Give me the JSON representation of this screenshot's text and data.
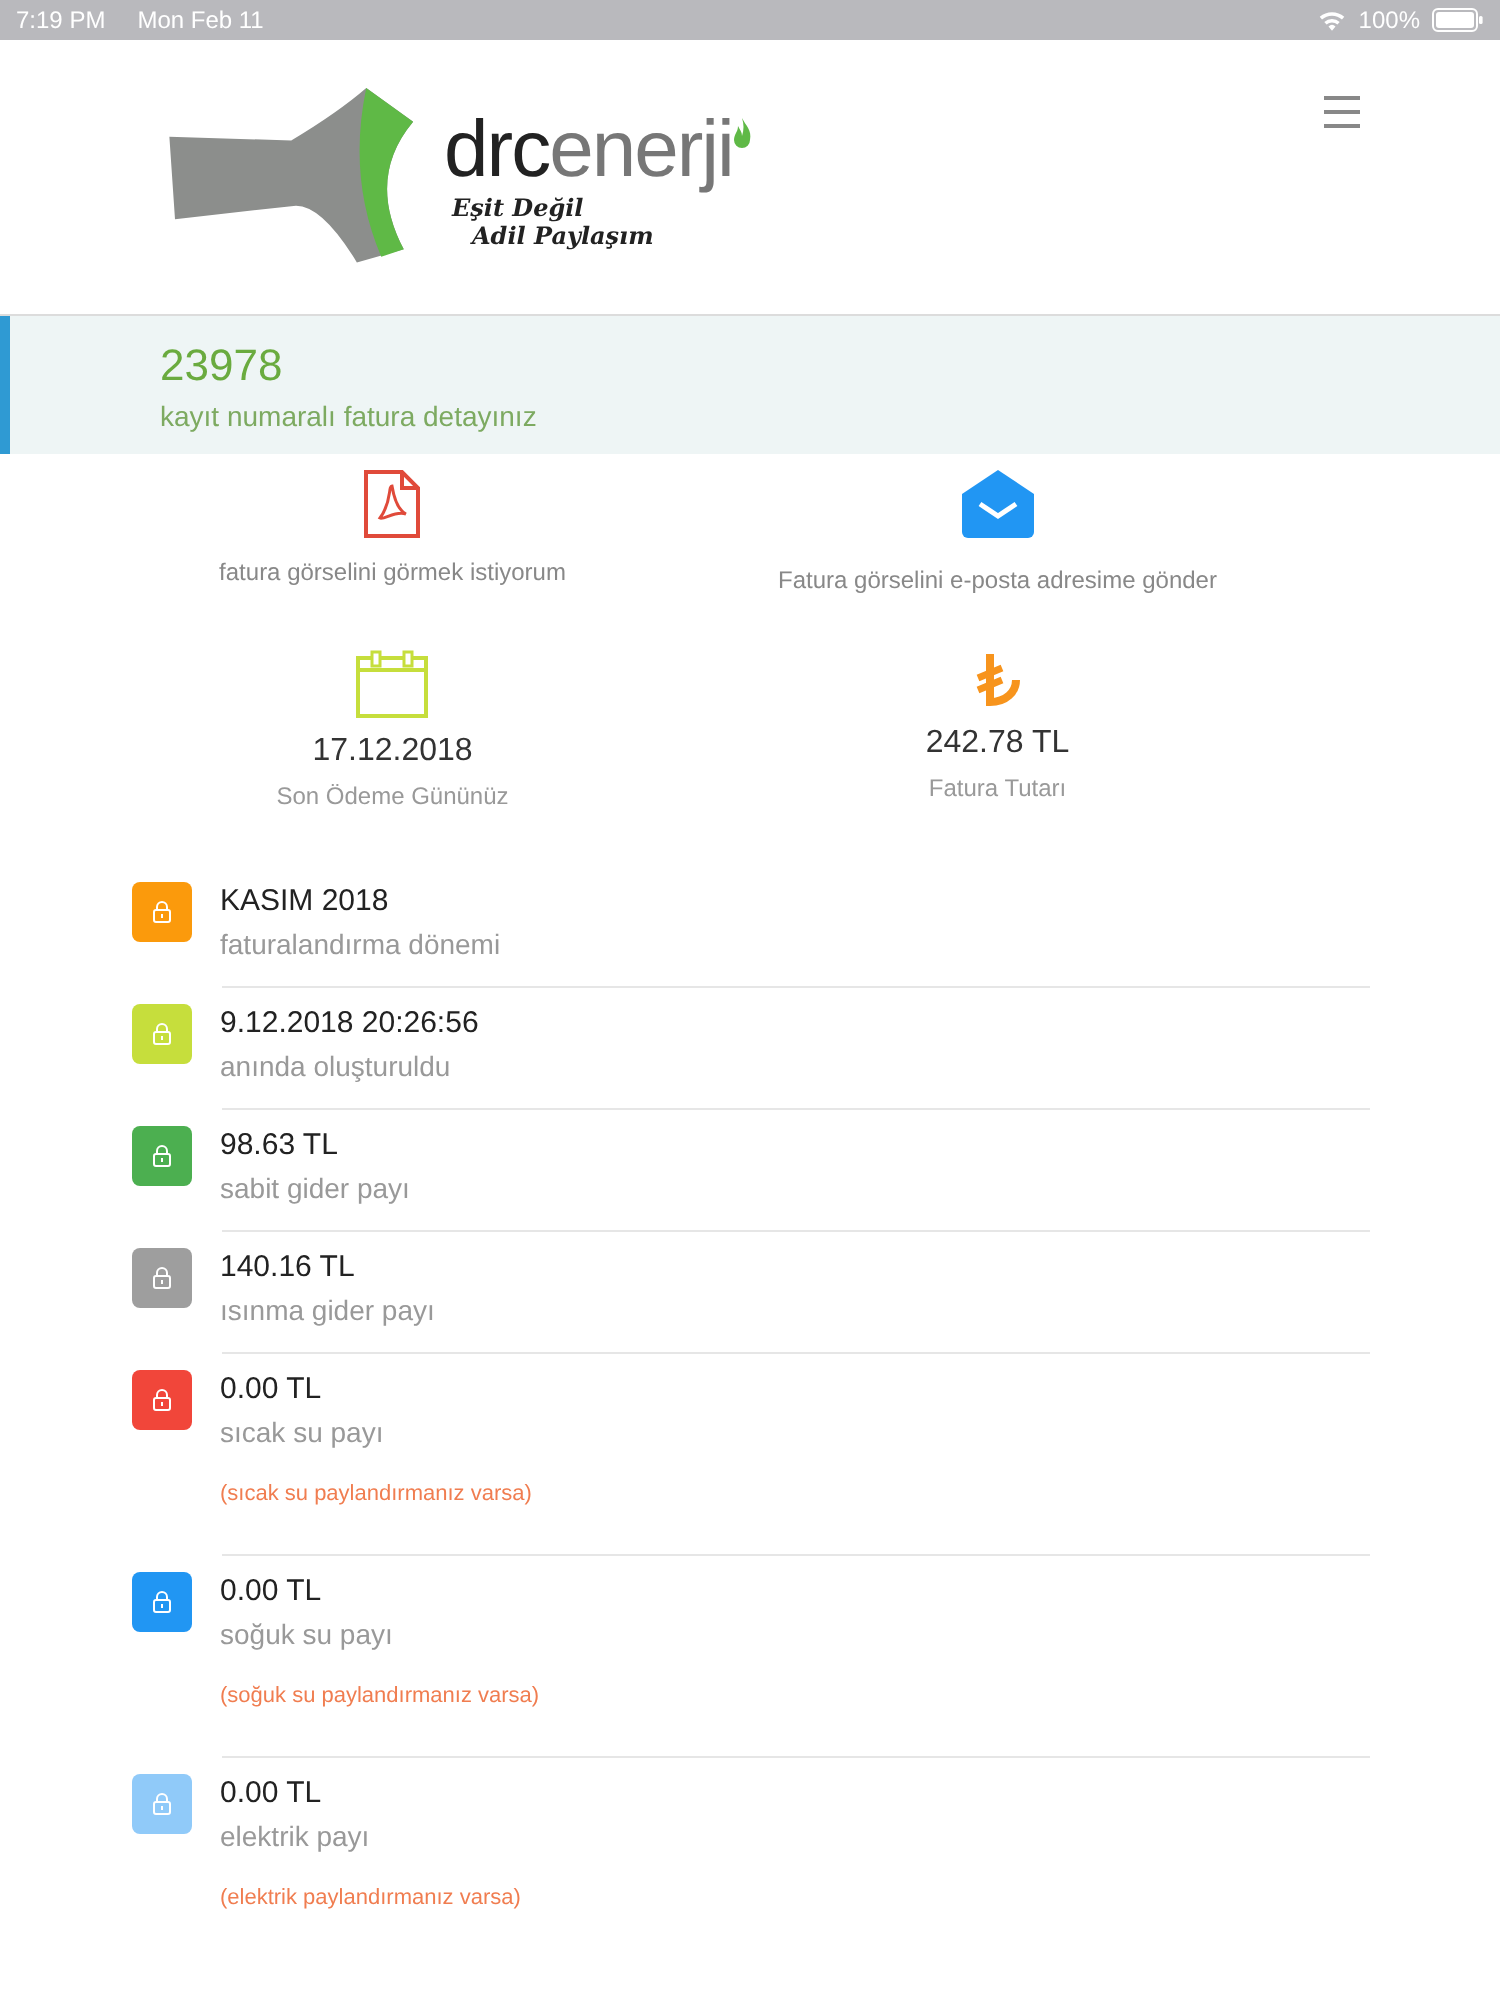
{
  "status_bar": {
    "time": "7:19 PM",
    "date": "Mon Feb 11",
    "battery": "100%"
  },
  "logo": {
    "brand_dark": "drc",
    "brand_light": "enerji",
    "slogan_1": "Eşit Değil",
    "slogan_2": "Adil Paylaşım"
  },
  "banner": {
    "number": "23978",
    "subtitle": "kayıt numaralı fatura detayınız"
  },
  "actions": [
    {
      "kind": "pdf",
      "label": "fatura görselini görmek istiyorum"
    },
    {
      "kind": "mail",
      "label": "Fatura görselini e-posta adresime gönder"
    }
  ],
  "summary": [
    {
      "kind": "calendar",
      "value": "17.12.2018",
      "label": "Son Ödeme Gününüz"
    },
    {
      "kind": "lira",
      "value": "242.78 TL",
      "label": "Fatura Tutarı"
    }
  ],
  "details": [
    {
      "color": "#fb9a0c",
      "value": "KASIM 2018",
      "label": "faturalandırma dönemi"
    },
    {
      "color": "#c6de3c",
      "value": "9.12.2018 20:26:56",
      "label": "anında oluşturuldu"
    },
    {
      "color": "#4caf50",
      "value": "98.63 TL",
      "label": "sabit gider payı"
    },
    {
      "color": "#9e9e9e",
      "value": "140.16 TL",
      "label": "ısınma gider payı"
    },
    {
      "color": "#f1463a",
      "value": "0.00 TL",
      "label": "sıcak su payı",
      "note": "(sıcak su paylandırmanız varsa)"
    },
    {
      "color": "#2196f3",
      "value": "0.00 TL",
      "label": "soğuk su payı",
      "note": "(soğuk su paylandırmanız varsa)"
    },
    {
      "color": "#90caf9",
      "value": "0.00 TL",
      "label": "elektrik payı",
      "note": "(elektrik paylandırmanız varsa)"
    }
  ]
}
